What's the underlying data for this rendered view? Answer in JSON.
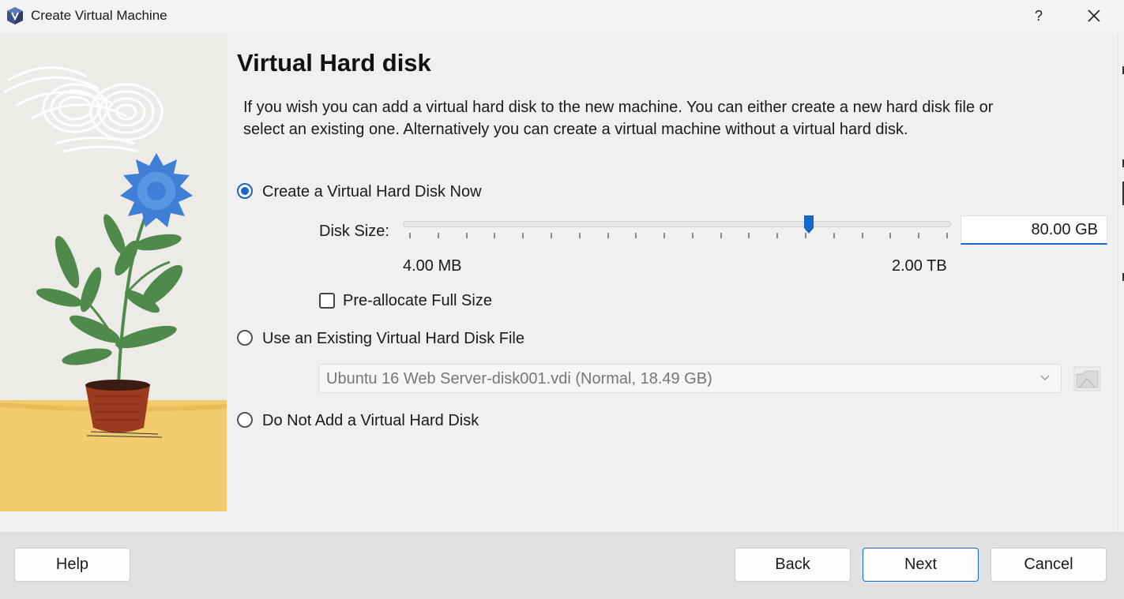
{
  "window": {
    "title": "Create Virtual Machine",
    "help_glyph": "?"
  },
  "page": {
    "title": "Virtual Hard disk",
    "description": "If you wish you can add a virtual hard disk to the new machine. You can either create a new hard disk file or select an existing one. Alternatively you can create a virtual machine without a virtual hard disk."
  },
  "options": {
    "create_now": {
      "label": "Create a Virtual Hard Disk Now",
      "selected": true
    },
    "use_existing": {
      "label": "Use an Existing Virtual Hard Disk File",
      "selected": false
    },
    "no_disk": {
      "label": "Do Not Add a Virtual Hard Disk",
      "selected": false
    }
  },
  "disk_size": {
    "label": "Disk Size:",
    "value": "80.00 GB",
    "min_label": "4.00 MB",
    "max_label": "2.00 TB",
    "slider_fraction": 0.74,
    "tick_count": 20
  },
  "preallocate": {
    "label": "Pre-allocate Full Size",
    "checked": false
  },
  "existing_file": {
    "selected": "Ubuntu 16 Web Server-disk001.vdi (Normal, 18.49 GB)"
  },
  "buttons": {
    "help": "Help",
    "back": "Back",
    "next": "Next",
    "cancel": "Cancel"
  },
  "colors": {
    "accent": "#1766c8",
    "footer_bg": "#e1e1e1",
    "illustration_floor": "#f1cb6c",
    "flower": "#3f7fd6",
    "pot": "#9c3a1f",
    "leaf": "#4f8a4c"
  },
  "icons": {
    "app": "virtualbox-cube-icon",
    "close": "close-icon",
    "combo": "chevron-down-icon",
    "folder": "folder-icon"
  }
}
